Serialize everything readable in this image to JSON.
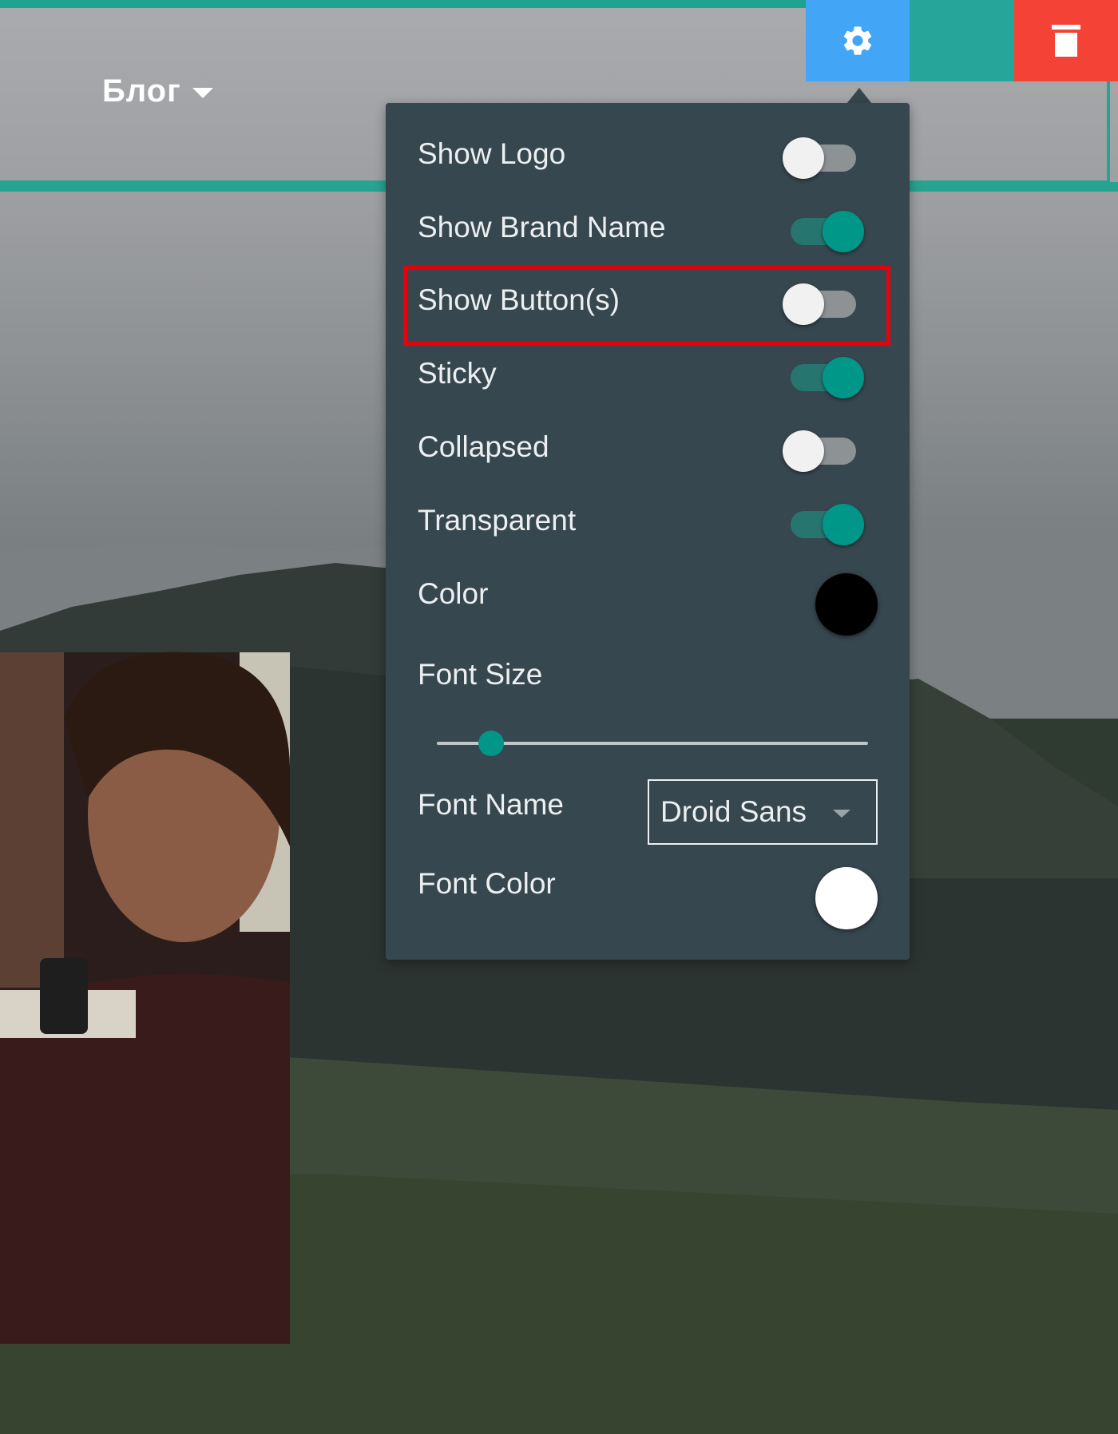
{
  "navbar": {
    "menu_label": "Блог"
  },
  "toolbar": {
    "settings_icon": "gear-icon",
    "delete_icon": "trash-icon",
    "colors": {
      "settings": "#42a5f5",
      "middle": "#26a69a",
      "delete": "#f44336"
    }
  },
  "settings_panel": {
    "toggles": [
      {
        "label": "Show Logo",
        "on": false
      },
      {
        "label": "Show Brand Name",
        "on": true
      },
      {
        "label": "Show Button(s)",
        "on": false
      },
      {
        "label": "Sticky",
        "on": true
      },
      {
        "label": "Collapsed",
        "on": false
      },
      {
        "label": "Transparent",
        "on": true
      }
    ],
    "color": {
      "label": "Color",
      "value": "#000000"
    },
    "font_size": {
      "label": "Font Size",
      "fraction": 0.126
    },
    "font_name": {
      "label": "Font Name",
      "value": "Droid Sans"
    },
    "font_color": {
      "label": "Font Color",
      "value": "#ffffff"
    }
  }
}
